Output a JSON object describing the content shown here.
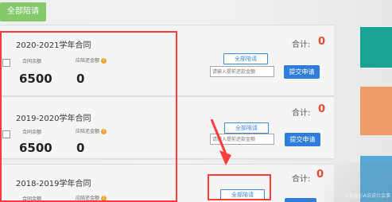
{
  "top_button": {
    "label": "全部陪请"
  },
  "contracts": [
    {
      "title": "2020-2021学年合同",
      "amount_label": "合同余额",
      "repay_label": "应陪还金额",
      "amount_value": "6500",
      "repay_value": "0",
      "total_label": "合计:",
      "total_value": "0",
      "all_button": "全部陪请",
      "input_placeholder": "请输入提前还款金额",
      "submit_button": "提交申请"
    },
    {
      "title": "2019-2020学年合同",
      "amount_label": "合同余额",
      "repay_label": "应陪还金额",
      "amount_value": "6500",
      "repay_value": "0",
      "total_label": "合计:",
      "total_value": "0",
      "all_button": "全部陪请",
      "input_placeholder": "请输入提前还款金额",
      "submit_button": "提交申请"
    },
    {
      "title": "2018-2019学年合同",
      "amount_label": "合同余额",
      "repay_label": "应陪还金额",
      "amount_value": "",
      "repay_value": "",
      "total_label": "合计:",
      "total_value": "0",
      "all_button": "全部陪请",
      "input_placeholder": "",
      "submit_button": ""
    }
  ],
  "watermark": "头条@小A说说社会事",
  "colors": {
    "accent_blue": "#2f7ddb",
    "highlight_red": "#ff3c3c",
    "green_button": "#84c96b",
    "total_red": "#e34b2d"
  },
  "icons": {
    "info": "info-icon",
    "arrow": "red-arrow-icon",
    "checkbox": "checkbox-icon"
  }
}
